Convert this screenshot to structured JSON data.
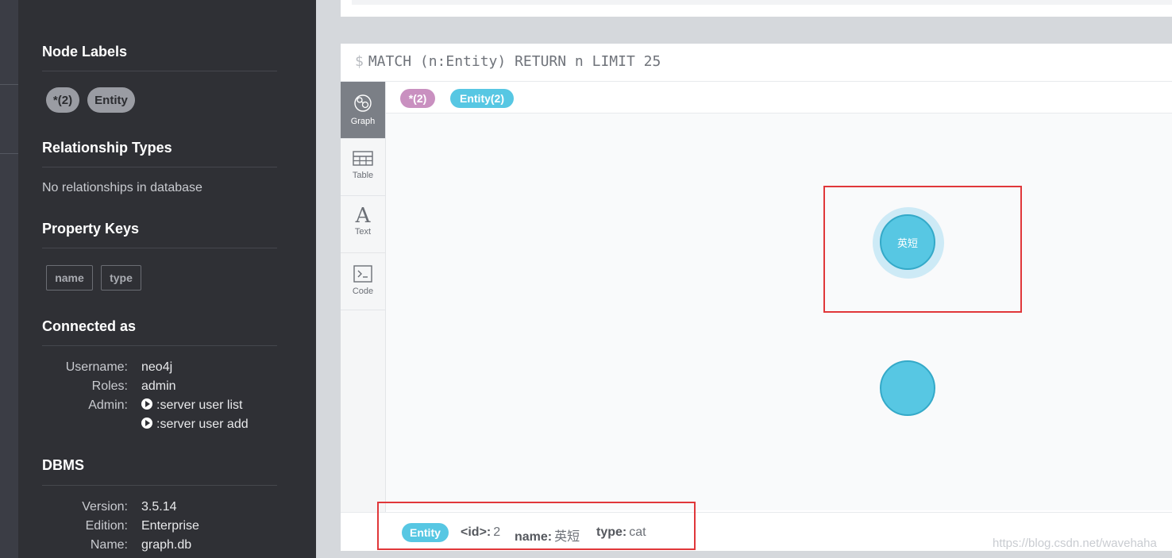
{
  "sidebar": {
    "node_labels": {
      "title": "Node Labels",
      "items": [
        "*(2)",
        "Entity"
      ]
    },
    "relationship_types": {
      "title": "Relationship Types",
      "empty_text": "No relationships in database"
    },
    "property_keys": {
      "title": "Property Keys",
      "items": [
        "name",
        "type"
      ]
    },
    "connected_as": {
      "title": "Connected as",
      "username_label": "Username:",
      "username": "neo4j",
      "roles_label": "Roles:",
      "roles": "admin",
      "admin_label": "Admin:",
      "commands": [
        ":server user list",
        ":server user add"
      ]
    },
    "dbms": {
      "title": "DBMS",
      "version_label": "Version:",
      "version": "3.5.14",
      "edition_label": "Edition:",
      "edition": "Enterprise",
      "name_label": "Name:",
      "name": "graph.db"
    }
  },
  "frame": {
    "prompt": "$",
    "query": "MATCH (n:Entity) RETURN n LIMIT 25",
    "view_tabs": [
      {
        "label": "Graph",
        "icon": "graph-icon",
        "active": true
      },
      {
        "label": "Table",
        "icon": "table-icon",
        "active": false
      },
      {
        "label": "Text",
        "icon": "text-icon",
        "active": false
      },
      {
        "label": "Code",
        "icon": "code-icon",
        "active": false
      }
    ],
    "legend": {
      "all_label": "*(2)",
      "all_color": "#c990c0",
      "entity_label": "Entity(2)",
      "entity_color": "#57c7e3"
    },
    "nodes": [
      {
        "caption": "英短",
        "selected": true
      },
      {
        "caption": "",
        "selected": false
      }
    ],
    "status": {
      "label": "Entity",
      "id_key": "<id>:",
      "id_value": "2",
      "name_key": "name:",
      "name_value": "英短",
      "type_key": "type:",
      "type_value": "cat"
    }
  },
  "watermark": "https://blog.csdn.net/wavehaha"
}
